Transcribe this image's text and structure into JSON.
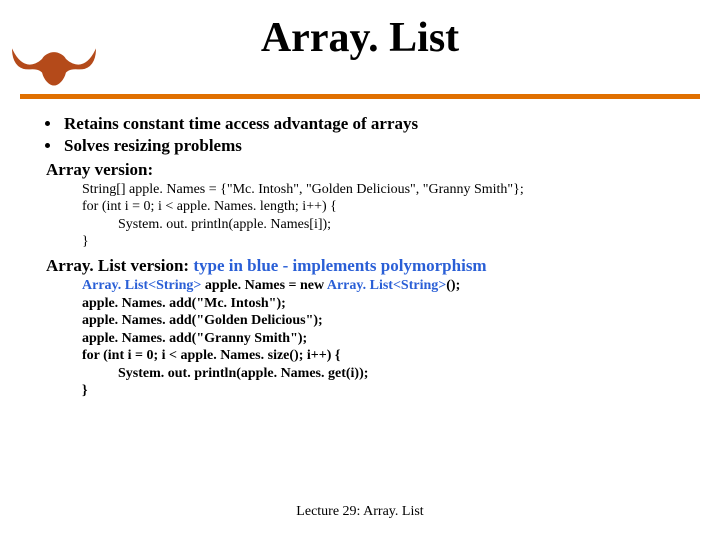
{
  "title": "Array. List",
  "bullets": [
    "Retains constant time access advantage of arrays",
    "Solves resizing problems"
  ],
  "array_version_label": "Array version:",
  "array_code": {
    "l1": "String[] apple. Names = {\"Mc. Intosh\", \"Golden Delicious\", \"Granny Smith\"};",
    "l2": "for (int i = 0; i < apple. Names. length; i++) {",
    "l3": "System. out. println(apple. Names[i]);",
    "l4": "}"
  },
  "arraylist_label_prefix": "Array. List version:",
  "arraylist_label_suffix": " type in blue - implements polymorphism",
  "arraylist_code": {
    "l1a": "Array. List",
    "l1b": "<String>",
    "l1c": " apple. Names = new ",
    "l1d": "Array. List",
    "l1e": "<String>",
    "l1f": "();",
    "l2": "apple. Names. add(\"Mc. Intosh\");",
    "l3": "apple. Names. add(\"Golden Delicious\");",
    "l4": "apple. Names. add(\"Granny Smith\");",
    "l5": "for (int i = 0; i < apple. Names. size(); i++) {",
    "l6": "System. out. println(apple. Names. get(i));",
    "l7": "}"
  },
  "footer": "Lecture 29: Array. List"
}
